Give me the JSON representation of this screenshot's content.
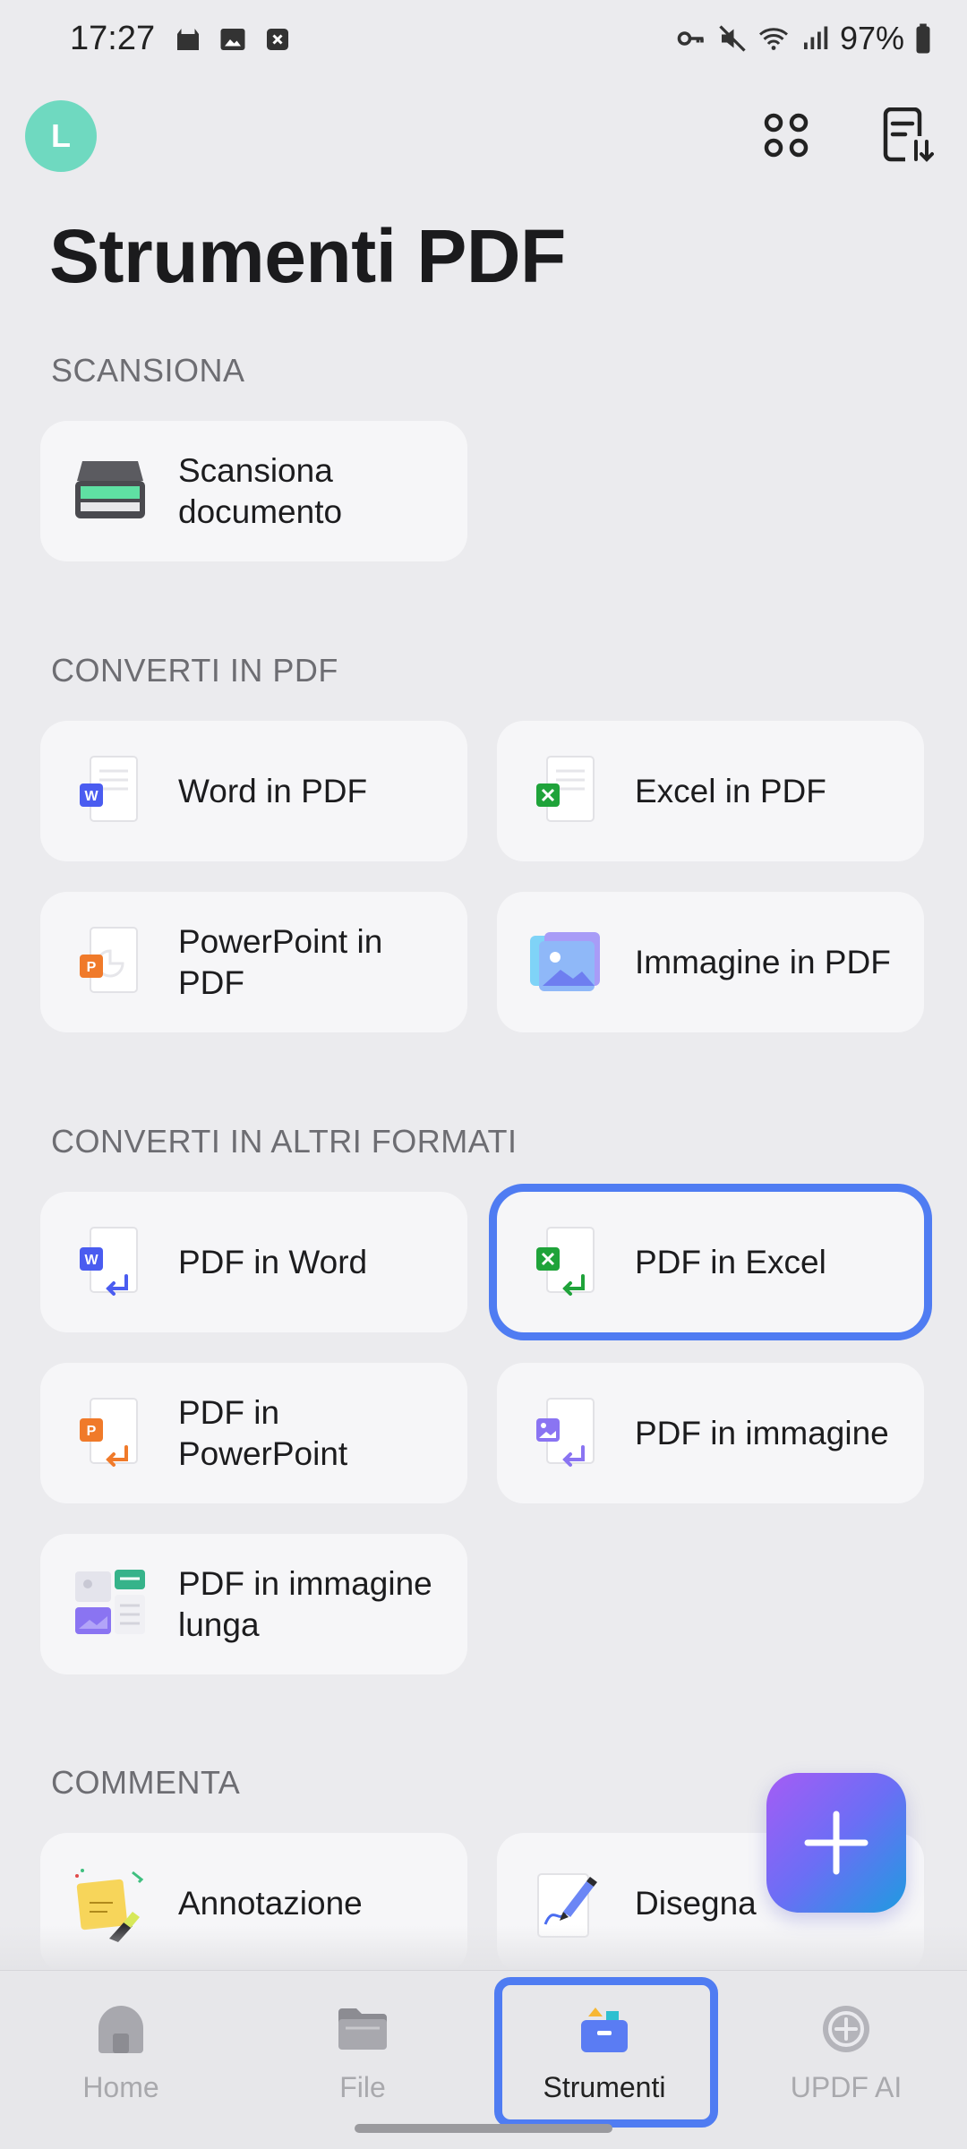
{
  "status": {
    "time": "17:27",
    "battery": "97%"
  },
  "header": {
    "avatar_letter": "L",
    "title": "Strumenti PDF"
  },
  "sections": {
    "scan": {
      "label": "SCANSIONA",
      "items": [
        {
          "label_l1": "Scansiona",
          "label_l2": "documento",
          "icon": "scanner-icon"
        }
      ]
    },
    "to_pdf": {
      "label": "CONVERTI IN PDF",
      "items": [
        {
          "label_l1": "Word in PDF",
          "icon": "word-doc-icon"
        },
        {
          "label_l1": "Excel in PDF",
          "icon": "excel-doc-icon"
        },
        {
          "label_l1": "PowerPoint in",
          "label_l2": "PDF",
          "icon": "powerpoint-doc-icon"
        },
        {
          "label_l1": "Immagine in PDF",
          "icon": "image-doc-icon"
        }
      ]
    },
    "from_pdf": {
      "label": "CONVERTI IN ALTRI FORMATI",
      "items": [
        {
          "label_l1": "PDF in Word",
          "icon": "pdf-to-word-icon"
        },
        {
          "label_l1": "PDF in Excel",
          "icon": "pdf-to-excel-icon",
          "selected": true
        },
        {
          "label_l1": "PDF in",
          "label_l2": "PowerPoint",
          "icon": "pdf-to-powerpoint-icon"
        },
        {
          "label_l1": "PDF in immagine",
          "icon": "pdf-to-image-icon"
        },
        {
          "label_l1": "PDF in immagine",
          "label_l2": "lunga",
          "icon": "pdf-to-long-image-icon"
        }
      ]
    },
    "comment": {
      "label": "COMMENTA",
      "items": [
        {
          "label_l1": "Annotazione",
          "icon": "sticky-note-icon"
        },
        {
          "label_l1": "Disegna",
          "icon": "pen-draw-icon"
        }
      ]
    }
  },
  "fab": {
    "icon": "plus-icon"
  },
  "nav": [
    {
      "label": "Home",
      "icon": "home-icon"
    },
    {
      "label": "File",
      "icon": "folder-icon"
    },
    {
      "label": "Strumenti",
      "icon": "toolbox-icon",
      "active": true
    },
    {
      "label": "UPDF AI",
      "icon": "ai-icon"
    }
  ],
  "colors": {
    "accent": "#4f7cf2",
    "word": "#4a5cf0",
    "excel": "#1fa33a",
    "powerpoint": "#f07a2a",
    "image": "#8a74f2"
  }
}
